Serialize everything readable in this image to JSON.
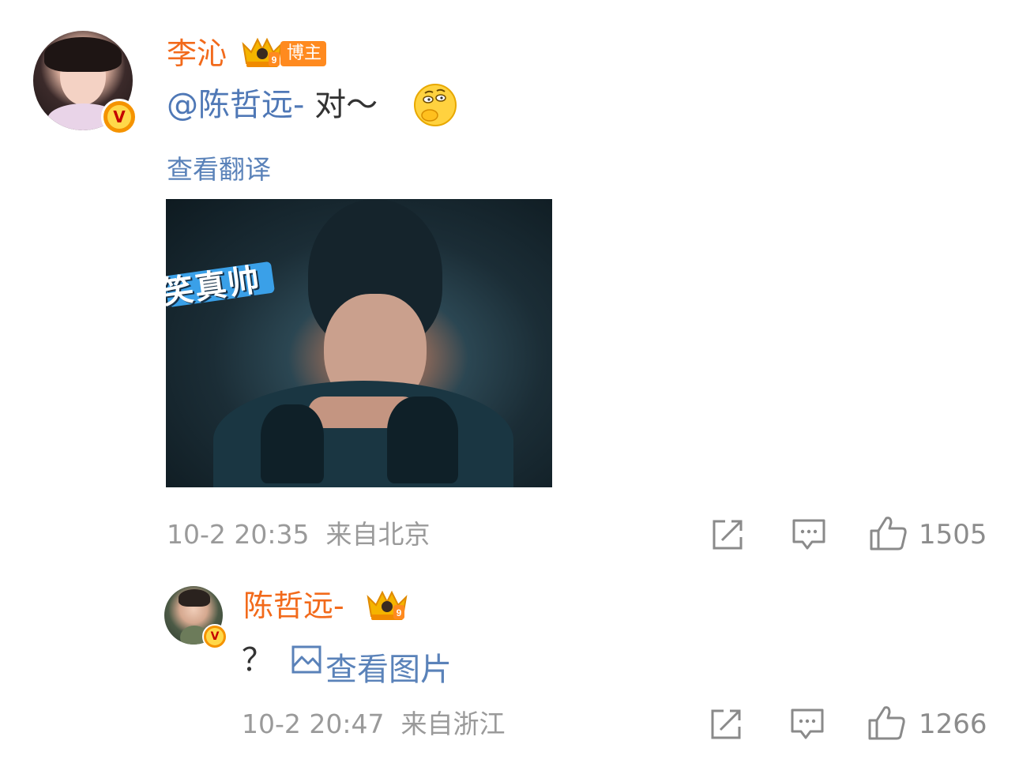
{
  "comment": {
    "author": "李沁",
    "badge_label": "博主",
    "mention": "@陈哲远-",
    "text": " 对～",
    "emoji": "thinking-emoji",
    "translate_link": "查看翻译",
    "image_overlay_text": "笑真帅",
    "time": "10-2 20:35",
    "location": "来自北京",
    "like_count": "1505"
  },
  "reply": {
    "author": "陈哲远-",
    "text": "？",
    "view_image_link": "查看图片",
    "time": "10-2 20:47",
    "location": "来自浙江",
    "like_count": "1266"
  },
  "colors": {
    "name": "#f26a1b",
    "link": "#5a82b9",
    "meta": "#9a9a9a",
    "badge_bg": "#ff8a1f"
  }
}
